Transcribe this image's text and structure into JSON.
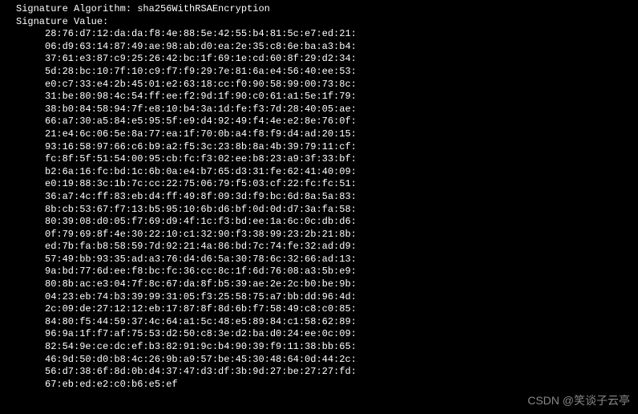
{
  "header": {
    "algorithm_label": "Signature Algorithm: sha256WithRSAEncryption",
    "value_label": "Signature Value:"
  },
  "signature_hex_lines": [
    "28:76:d7:12:da:da:f8:4e:88:5e:42:55:b4:81:5c:e7:ed:21:",
    "06:d9:63:14:87:49:ae:98:ab:d0:ea:2e:35:c8:6e:ba:a3:b4:",
    "37:61:e3:87:c9:25:26:42:bc:1f:69:1e:cd:60:8f:29:d2:34:",
    "5d:28:bc:10:7f:10:c9:f7:f9:29:7e:81:6a:e4:56:40:ee:53:",
    "e0:c7:33:e4:2b:45:01:e2:63:18:cc:f0:90:58:99:00:73:8c:",
    "31:be:80:98:4c:54:ff:ee:f2:9d:1f:90:c0:61:a1:5e:1f:79:",
    "38:b0:84:58:94:7f:e8:10:b4:3a:1d:fe:f3:7d:28:40:05:ae:",
    "66:a7:30:a5:84:e5:95:5f:e9:d4:92:49:f4:4e:e2:8e:76:0f:",
    "21:e4:6c:06:5e:8a:77:ea:1f:70:0b:a4:f8:f9:d4:ad:20:15:",
    "93:16:58:97:66:c6:b9:a2:f5:3c:23:8b:8a:4b:39:79:11:cf:",
    "fc:8f:5f:51:54:00:95:cb:fc:f3:02:ee:b8:23:a9:3f:33:bf:",
    "b2:6a:16:fc:bd:1c:6b:0a:e4:b7:65:d3:31:fe:62:41:40:09:",
    "e0:19:88:3c:1b:7c:cc:22:75:06:79:f5:03:cf:22:fc:fc:51:",
    "36:a7:4c:ff:83:eb:d4:ff:49:8f:09:3d:f9:bc:6d:8a:5a:83:",
    "8b:cb:53:67:f7:13:b5:95:10:6b:d6:bf:0d:0d:d7:3a:fa:58:",
    "80:39:08:d0:05:f7:69:d9:4f:1c:f3:bd:ee:1a:6c:0c:db:d6:",
    "0f:79:69:8f:4e:30:22:10:c1:32:90:f3:38:99:23:2b:21:8b:",
    "ed:7b:fa:b8:58:59:7d:92:21:4a:86:bd:7c:74:fe:32:ad:d9:",
    "57:49:bb:93:35:ad:a3:76:d4:d6:5a:30:78:6c:32:66:ad:13:",
    "9a:bd:77:6d:ee:f8:bc:fc:36:cc:8c:1f:6d:76:08:a3:5b:e9:",
    "80:8b:ac:e3:04:7f:8c:67:da:8f:b5:39:ae:2e:2c:b0:be:9b:",
    "04:23:eb:74:b3:39:99:31:05:f3:25:58:75:a7:bb:dd:96:4d:",
    "2c:09:de:27:12:12:eb:17:87:8f:8d:6b:f7:58:49:c8:c0:85:",
    "84:80:f5:44:59:37:4c:64:a1:5c:48:e5:89:84:c1:58:62:89:",
    "96:9a:1f:f7:af:75:53:d2:50:c8:3e:d2:ba:d0:24:ee:0c:09:",
    "82:54:9e:ce:dc:ef:b3:82:91:9c:b4:90:39:f9:11:38:bb:65:",
    "46:9d:50:d0:b8:4c:26:9b:a9:57:be:45:30:48:64:0d:44:2c:",
    "56:d7:38:6f:8d:0b:d4:37:47:d3:df:3b:9d:27:be:27:27:fd:",
    "67:eb:ed:e2:c0:b6:e5:ef"
  ],
  "watermark": "CSDN @笑谈子云亭"
}
